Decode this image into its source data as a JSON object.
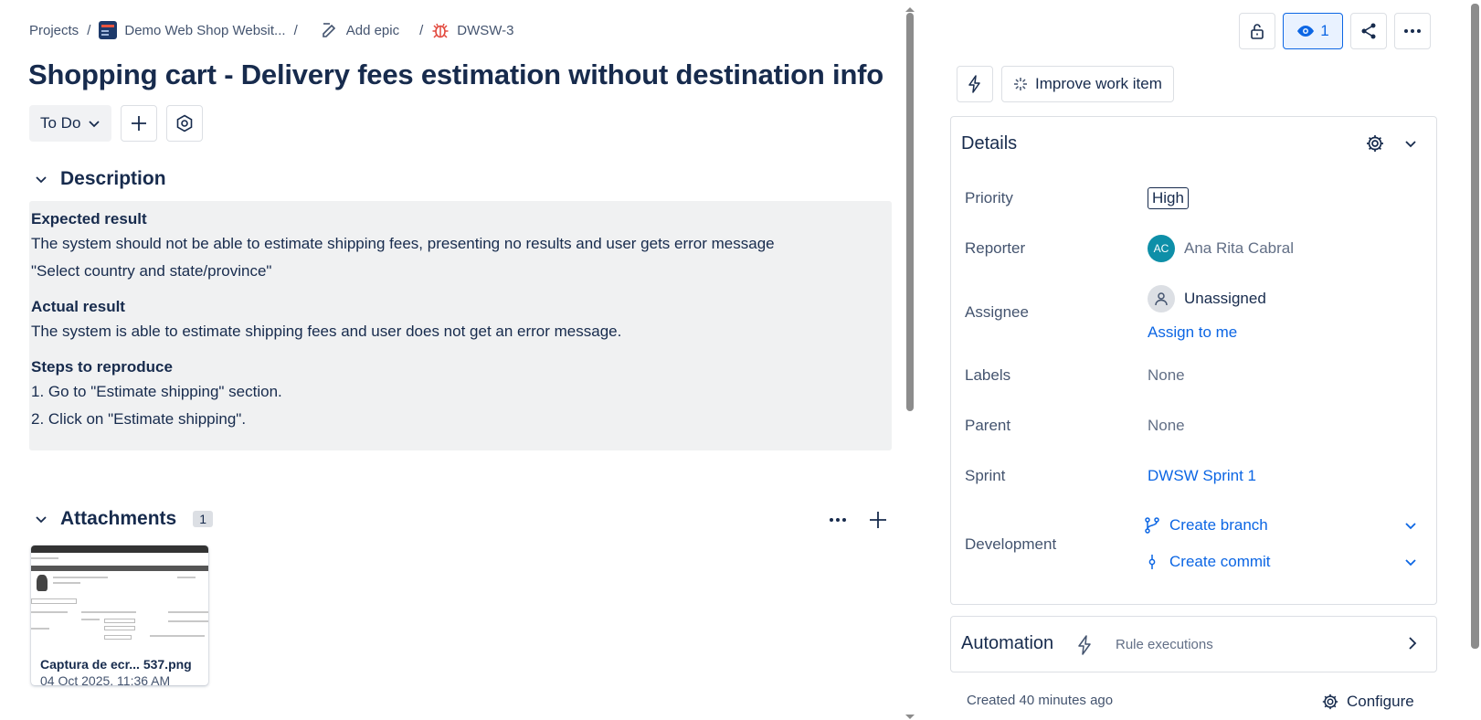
{
  "breadcrumb": {
    "projects": "Projects",
    "project_name": "Demo Web Shop Websit...",
    "add_epic": "Add epic",
    "issue_key": "DWSW-3"
  },
  "issue": {
    "title": "Shopping cart - Delivery fees estimation without destination info",
    "status": "To Do"
  },
  "description": {
    "heading": "Description",
    "expected_heading": "Expected result",
    "expected_line1": "The system should not be able to estimate shipping fees, presenting no results and user gets error message",
    "expected_line2": "\"Select country and state/province\"",
    "actual_heading": "Actual result",
    "actual_line1": "The system is able to estimate shipping fees and user does not get an error message.",
    "steps_heading": "Steps to reproduce",
    "step1": "1. Go to \"Estimate shipping\" section.",
    "step2": "2. Click on \"Estimate shipping\"."
  },
  "attachments": {
    "heading": "Attachments",
    "count": "1",
    "items": [
      {
        "name": "Captura de ecr... 537.png",
        "date": "04 Oct 2025, 11:36 AM"
      }
    ]
  },
  "toolbar": {
    "watch_count": "1",
    "improve_label": "Improve work item"
  },
  "details": {
    "heading": "Details",
    "priority_label": "Priority",
    "priority_value": "High",
    "reporter_label": "Reporter",
    "reporter_initials": "AC",
    "reporter_name": "Ana Rita Cabral",
    "assignee_label": "Assignee",
    "assignee_value": "Unassigned",
    "assign_to_me": "Assign to me",
    "labels_label": "Labels",
    "labels_value": "None",
    "parent_label": "Parent",
    "parent_value": "None",
    "sprint_label": "Sprint",
    "sprint_value": "DWSW Sprint 1",
    "development_label": "Development",
    "create_branch": "Create branch",
    "create_commit": "Create commit"
  },
  "automation": {
    "heading": "Automation",
    "sub": "Rule executions"
  },
  "footer": {
    "created": "Created 40 minutes ago",
    "configure": "Configure"
  },
  "colors": {
    "link": "#0c66e4",
    "text": "#172b4d",
    "description_bg": "#f0f1f2",
    "bug_icon": "#e2483d",
    "avatar_bg": "#0e8fa8"
  }
}
